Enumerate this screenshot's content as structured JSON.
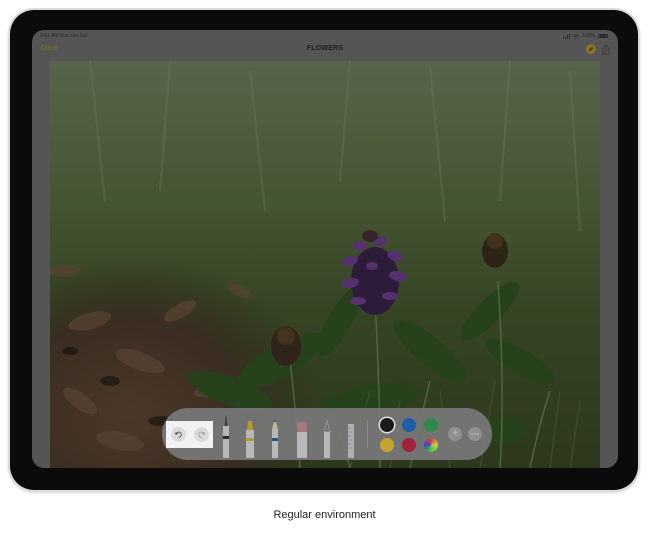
{
  "status_bar": {
    "time": "9:41 AM",
    "date": "Mon Jun 3rd",
    "battery": "100%"
  },
  "nav": {
    "done_label": "Done",
    "title": "FLOWERS"
  },
  "icons": {
    "markup": "markup-pen-icon",
    "share": "share-icon",
    "undo": "undo-icon",
    "redo": "redo-icon",
    "add": "plus-icon",
    "more": "more-icon"
  },
  "tools": [
    "pen",
    "marker",
    "pencil",
    "eraser",
    "lasso",
    "ruler"
  ],
  "colors": {
    "black": "#1a1a1a",
    "blue": "#1f5fa8",
    "green": "#2f8a4a",
    "yellow": "#c4a42a",
    "red": "#a3213a",
    "accent": "#8a7420"
  },
  "caption": "Regular environment"
}
